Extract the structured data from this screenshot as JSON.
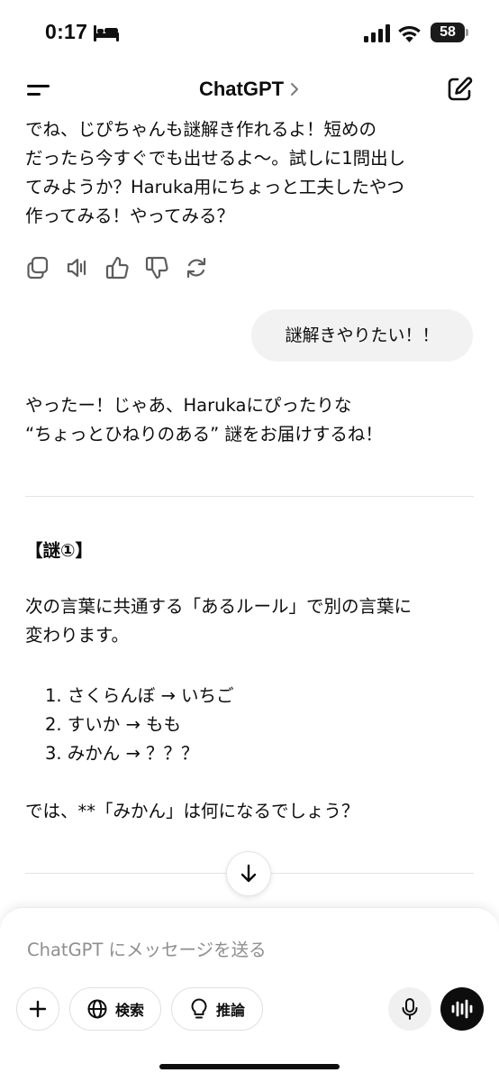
{
  "status_bar": {
    "time": "0:17",
    "battery": "58",
    "icons": [
      "bed-icon",
      "signal-icon",
      "wifi-icon",
      "battery-icon"
    ]
  },
  "nav": {
    "title": "ChatGPT",
    "icons": [
      "menu-icon",
      "chevron-right-icon",
      "new-chat-icon"
    ]
  },
  "assistant_message_1": {
    "lines": [
      "でね、じぴちゃんも謎解き作れるよ！短めの",
      "だったら今すぐでも出せるよ〜。試しに1問出し",
      "てみようか？Haruka用にちょっと工夫したやつ",
      "作ってみる！やってみる？"
    ],
    "action_icons": [
      "copy-icon",
      "read-aloud-icon",
      "thumbs-up-icon",
      "thumbs-down-icon",
      "regenerate-icon"
    ]
  },
  "user_message": {
    "text": "謎解きやりたい！！"
  },
  "assistant_message_2": {
    "intro_lines": [
      "やったー！じゃあ、Harukaにぴったりな",
      "“ちょっとひねりのある” 謎をお届けするね！"
    ],
    "riddle_heading": "【謎①】",
    "riddle_lines": [
      "次の言葉に共通する「あるルール」で別の言葉に",
      "変わります。"
    ],
    "riddle_items": [
      "1. さくらんぼ → いちご",
      "2. すいか → もも",
      "3. みかん → ？？？"
    ],
    "question": "では、**「みかん」は何になるでしょう？"
  },
  "composer": {
    "placeholder": "ChatGPT にメッセージを送る",
    "search_label": "検索",
    "reason_label": "推論",
    "icons": [
      "plus-icon",
      "globe-icon",
      "lightbulb-icon",
      "mic-icon",
      "voice-mode-icon",
      "arrow-down-icon"
    ]
  }
}
